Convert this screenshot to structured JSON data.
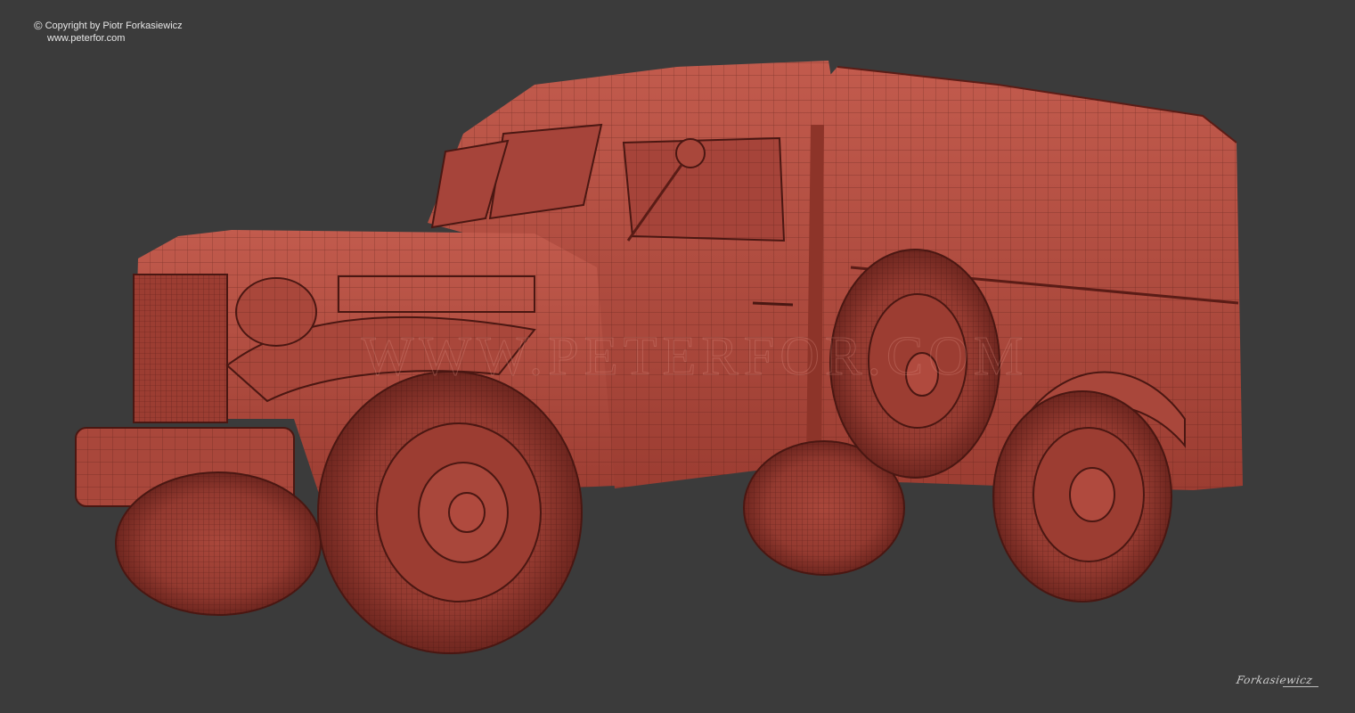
{
  "copyright": {
    "symbol": "©",
    "text": "Copyright by Piotr Forkasiewicz",
    "website": "www.peterfor.com"
  },
  "watermark": "WWW.PETERFOR.COM",
  "signature": "Forkasiewicz",
  "scene": {
    "subject": "vintage truck wireframe render",
    "background_color": "#3b3b3b",
    "body_color": "#b04a3e",
    "wire_color": "#4a1712"
  }
}
